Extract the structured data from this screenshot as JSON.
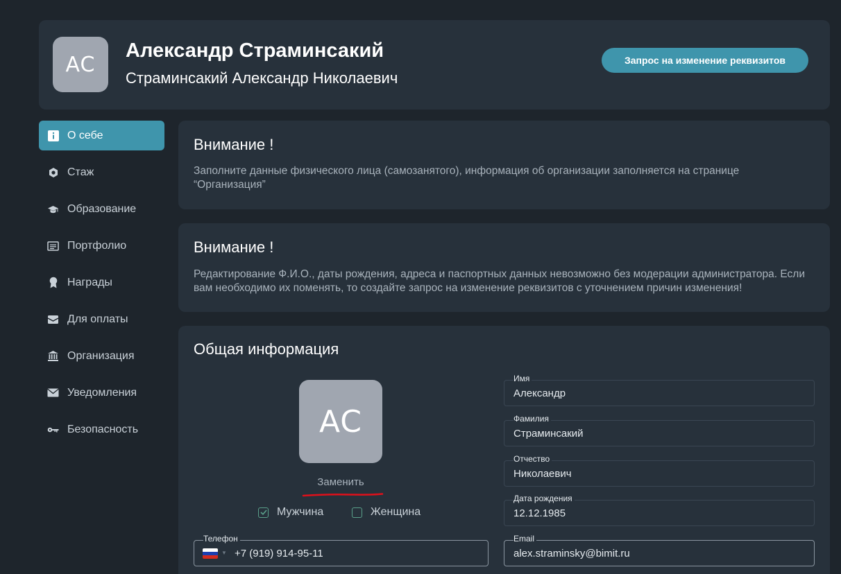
{
  "profile": {
    "initials": "AC",
    "display_name": "Александр Страминсакий",
    "full_name": "Страминсакий Александр Николаевич",
    "request_button": "Запрос на изменение реквизитов"
  },
  "sidebar": {
    "items": [
      {
        "label": "О себе",
        "icon": "info-icon",
        "active": true
      },
      {
        "label": "Стаж",
        "icon": "nut-icon"
      },
      {
        "label": "Образование",
        "icon": "graduation-cap-icon"
      },
      {
        "label": "Портфолио",
        "icon": "portfolio-icon"
      },
      {
        "label": "Награды",
        "icon": "award-icon"
      },
      {
        "label": "Для оплаты",
        "icon": "payment-icon"
      },
      {
        "label": "Организация",
        "icon": "bank-icon"
      },
      {
        "label": "Уведомления",
        "icon": "envelope-icon"
      },
      {
        "label": "Безопасность",
        "icon": "key-icon"
      }
    ]
  },
  "notices": [
    {
      "title": "Внимание !",
      "text": "Заполните данные физического лица (самозанятого), информация об организации заполняется на странице “Организация”"
    },
    {
      "title": "Внимание !",
      "text": "Редактирование Ф.И.О., даты рождения, адреса и паспортных данных невозможно без модерации администратора. Если вам необходимо их поменять, то создайте запрос на изменение реквизитов с уточнением причин изменения!"
    }
  ],
  "general": {
    "title": "Общая информация",
    "avatar_initials": "AC",
    "replace_label": "Заменить",
    "gender": {
      "male_label": "Мужчина",
      "female_label": "Женщина",
      "selected": "male"
    },
    "fields": {
      "first_name": {
        "label": "Имя",
        "value": "Александр"
      },
      "last_name": {
        "label": "Фамилия",
        "value": "Страминсакий"
      },
      "patronymic": {
        "label": "Отчество",
        "value": "Николаевич"
      },
      "birth_date": {
        "label": "Дата рождения",
        "value": "12.12.1985"
      },
      "phone": {
        "label": "Телефон",
        "value": "+7 (919) 914-95-11"
      },
      "email": {
        "label": "Email",
        "value": "alex.straminsky@bimit.ru"
      }
    }
  },
  "colors": {
    "accent": "#3f95ac",
    "page_bg": "#1e252c",
    "card_bg": "#27313b",
    "annotation": "#e0101a"
  }
}
